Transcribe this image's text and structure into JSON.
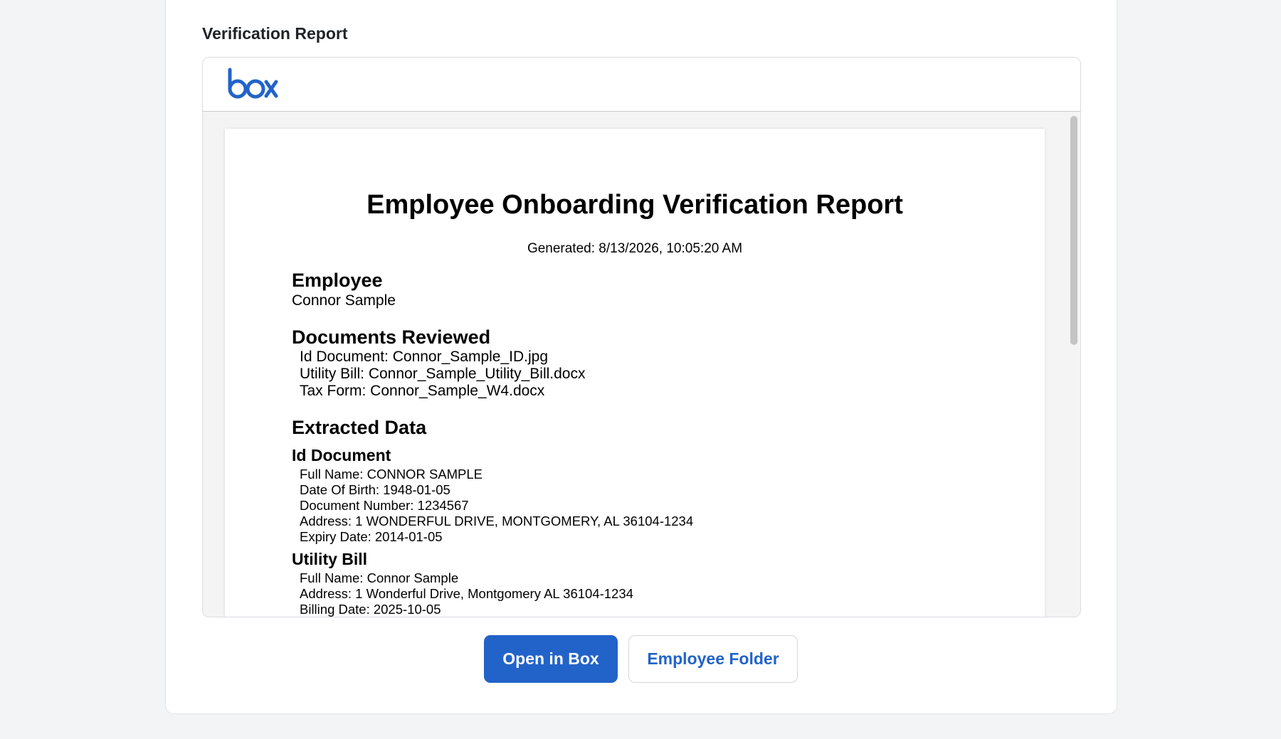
{
  "section_title": "Verification Report",
  "viewer": {
    "logo_text": "box",
    "brand_color": "#2263c9"
  },
  "report": {
    "title": "Employee Onboarding Verification Report",
    "generated": "Generated: 8/13/2026, 10:05:20 AM",
    "employee_heading": "Employee",
    "employee_name": "Connor Sample",
    "documents_heading": "Documents Reviewed",
    "documents": [
      "Id Document: Connor_Sample_ID.jpg",
      "Utility Bill: Connor_Sample_Utility_Bill.docx",
      "Tax Form: Connor_Sample_W4.docx"
    ],
    "extracted_heading": "Extracted Data",
    "id_document": {
      "heading": "Id Document",
      "fields": [
        "Full Name: CONNOR SAMPLE",
        "Date Of Birth: 1948-01-05",
        "Document Number: 1234567",
        "Address: 1 WONDERFUL DRIVE, MONTGOMERY, AL 36104-1234",
        "Expiry Date: 2014-01-05"
      ]
    },
    "utility_bill": {
      "heading": "Utility Bill",
      "fields": [
        "Full Name: Connor Sample",
        "Address: 1 Wonderful Drive, Montgomery AL 36104-1234",
        "Billing Date: 2025-10-05"
      ]
    }
  },
  "buttons": {
    "open_in_box": "Open in Box",
    "employee_folder": "Employee Folder"
  }
}
